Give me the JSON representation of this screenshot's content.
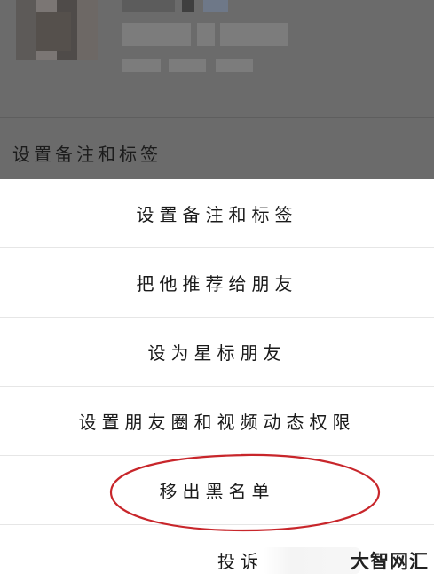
{
  "background": {
    "remark_setting_label": "设置备注和标签"
  },
  "action_sheet": {
    "items": [
      {
        "label": "设置备注和标签"
      },
      {
        "label": "把他推荐给朋友"
      },
      {
        "label": "设为星标朋友"
      },
      {
        "label": "设置朋友圈和视频动态权限"
      },
      {
        "label": "移出黑名单"
      },
      {
        "label": "投诉"
      }
    ]
  },
  "annotation": {
    "color": "#c8262b",
    "highlighted_item": "移出黑名单"
  },
  "watermark": {
    "text": "大智网汇"
  },
  "colors": {
    "overlay": "#6b6b6b",
    "sheet_bg": "#ffffff",
    "divider": "#e6e6e6",
    "text": "#1a1a1a"
  }
}
